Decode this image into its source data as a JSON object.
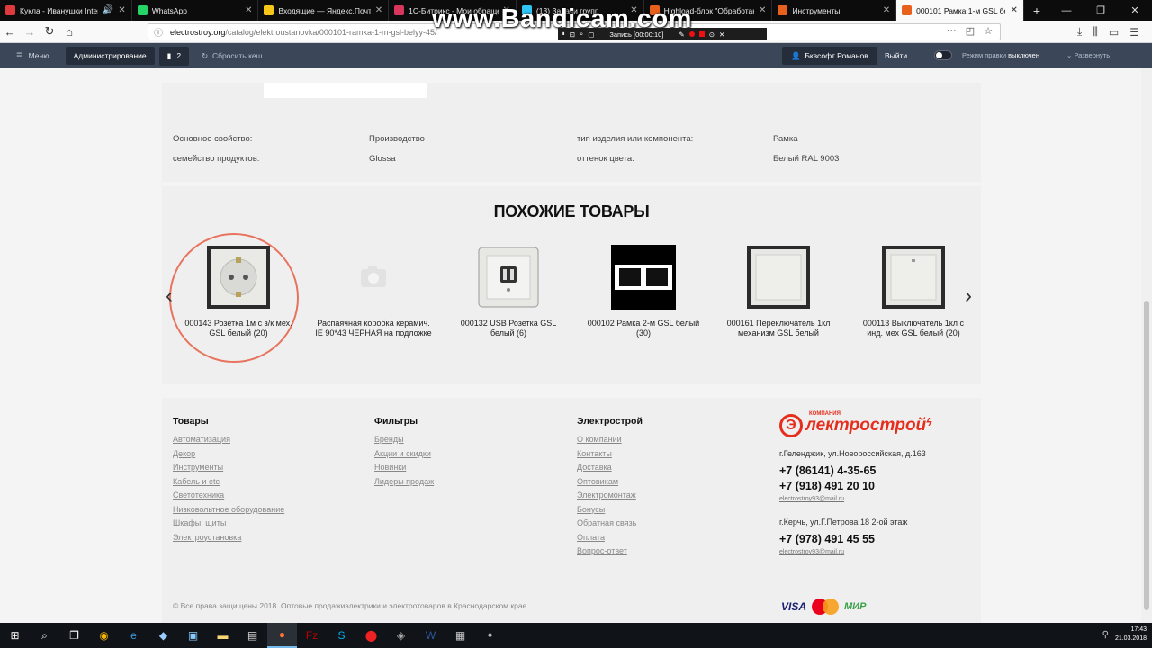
{
  "tabs": [
    {
      "title": "Кукла - Иванушки Intern",
      "icon": "yandex-music-icon",
      "color": "#e0393e",
      "width": 147
    },
    {
      "title": "WhatsApp",
      "icon": "whatsapp-icon",
      "color": "#25d366",
      "width": 141
    },
    {
      "title": "Входящие — Яндекс.Почта",
      "icon": "mail-icon",
      "color": "#f5c518",
      "width": 145
    },
    {
      "title": "1С-Битрикс - Мои обращен",
      "icon": "bitrix-icon",
      "color": "#d9365d",
      "width": 142
    },
    {
      "title": "(13) Задачи групп",
      "icon": "bitrix-icon",
      "color": "#2fc6f6",
      "width": 142
    },
    {
      "title": "Highload-блок \"Обработан",
      "icon": "bitrix-icon",
      "color": "#e8611c",
      "width": 143
    },
    {
      "title": "Инструменты",
      "icon": "tools-icon",
      "color": "#e8611c",
      "width": 138
    },
    {
      "title": "000101 Рамка 1-м GSL белы",
      "icon": "site-icon",
      "color": "#e8611c",
      "width": 142,
      "active": true
    }
  ],
  "url": {
    "host": "electrostroy.org",
    "path": "/catalog/elektroustanovka/000101-ramka-1-m-gsl-belyy-45/"
  },
  "overlay": {
    "watermark": "www.Bandicam.com",
    "recording": "Запись [00:00:10]"
  },
  "admin": {
    "menu": "Меню",
    "admin_label": "Администрирование",
    "count": "2",
    "cache": "Сбросить кеш",
    "user": "Бквсофт Романов",
    "logout": "Выйти",
    "edit_mode": "Режим правки",
    "edit_state": "выключен",
    "expand": "Развернуть"
  },
  "props": [
    {
      "label": "Основное свойство:",
      "value": "Производство",
      "label2": "тип изделия или компонента:",
      "value2": "Рамка"
    },
    {
      "label": "семейство продуктов:",
      "value": "Glossa",
      "label2": "оттенок цвета:",
      "value2": "Белый RAL 9003"
    }
  ],
  "similar": {
    "title": "ПОХОЖИЕ ТОВАРЫ",
    "items": [
      {
        "name": "000143 Розетка 1м с з/к мех. GSL белый (20)",
        "icon": "socket-icon"
      },
      {
        "name": "Распаячная коробка керамич. IE 90*43 ЧЁРНАЯ на подложке",
        "icon": "camera-placeholder-icon"
      },
      {
        "name": "000132 USB Розетка GSL белый (6)",
        "icon": "usb-socket-icon"
      },
      {
        "name": "000102 Рамка 2-м GSL белый (30)",
        "icon": "frame-2-icon"
      },
      {
        "name": "000161 Переключатель 1кл механизм GSL белый",
        "icon": "switch-icon"
      },
      {
        "name": "000113 Выключатель 1кл с инд. мех GSL белый (20)",
        "icon": "switch-indicator-icon"
      }
    ]
  },
  "footer": {
    "col1": {
      "title": "Товары",
      "links": [
        "Автоматизация",
        "Декор",
        "Инструменты",
        "Кабель и etc",
        "Светотехника",
        "Низковольтное оборудование",
        "Шкафы, щиты",
        "Электроустановка"
      ]
    },
    "col2": {
      "title": "Фильтры",
      "links": [
        "Бренды",
        "Акции и скидки",
        "Новинки",
        "Лидеры продаж"
      ]
    },
    "col3": {
      "title": "Электрострой",
      "links": [
        "О компании",
        "Контакты",
        "Доставка",
        "Оптовикам",
        "Электромонтаж",
        "Бонусы",
        "Обратная связь",
        "Оплата",
        "Вопрос-ответ"
      ]
    },
    "logo": {
      "company": "КОМПАНИЯ",
      "name": "лектрострой",
      "initial": "Э"
    },
    "addr1": "г.Геленджик, ул.Новороссийская, д.163",
    "phone1": "+7 (86141) 4-35-65",
    "phone2": "+7 (918) 491 20 10",
    "mail1": "electrostroy93@mail.ru",
    "addr2": "г.Керчь, ул.Г.Петрова 18 2-ой этаж",
    "phone3": "+7 (978) 491 45 55",
    "mail2": "electrostroy93@mail.ru",
    "copyright": "© Все права защищены 2018. Оптовые продажиэлектрики и электротоваров в Краснодарском крае",
    "payments": {
      "visa": "VISA",
      "mir": "МИР"
    }
  },
  "taskbar": {
    "time": "17:43",
    "date": "21.03.2018"
  },
  "colors": {
    "admin_bar": "#3c4659",
    "accent": "#e8735e",
    "brand": "#e62e1e"
  }
}
